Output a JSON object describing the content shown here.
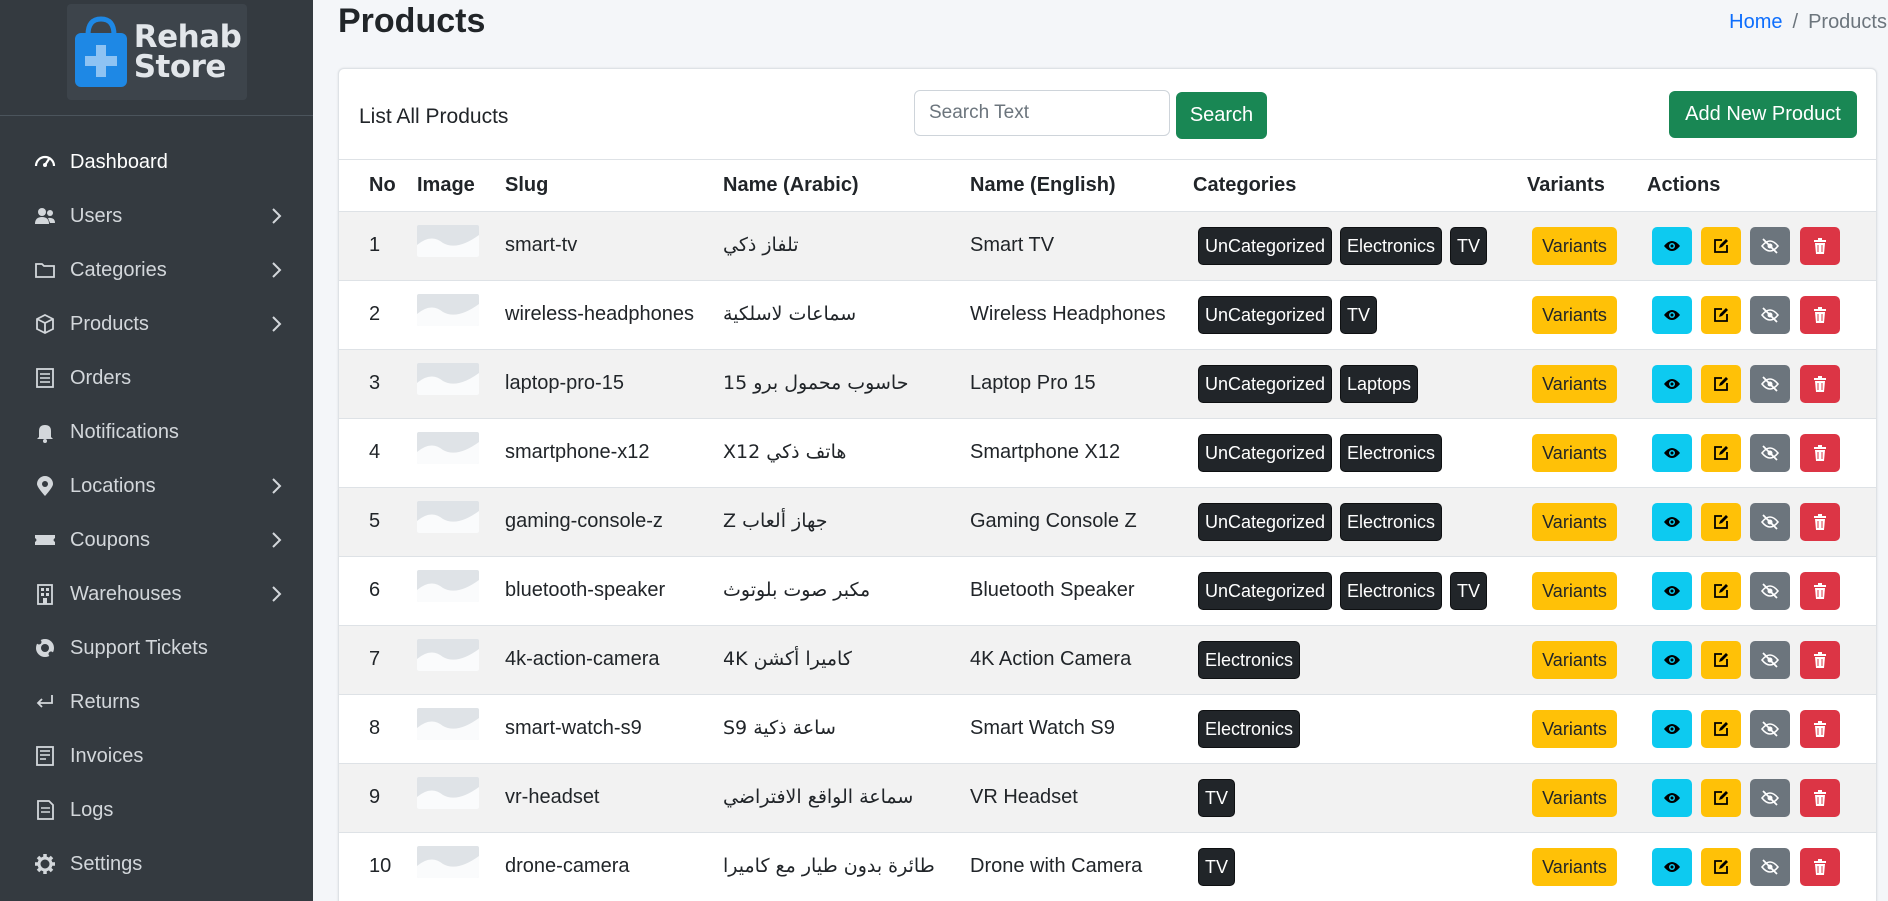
{
  "sidebar": {
    "brand": {
      "line1": "Rehab",
      "line2": "Store",
      "icon": "shopping-bag-plus-icon",
      "accent": "#1e88e5"
    },
    "items": [
      {
        "label": "Dashboard",
        "icon": "gauge-icon",
        "active": true,
        "has_submenu": false
      },
      {
        "label": "Users",
        "icon": "users-icon",
        "active": false,
        "has_submenu": true
      },
      {
        "label": "Categories",
        "icon": "folder-icon",
        "active": false,
        "has_submenu": true
      },
      {
        "label": "Products",
        "icon": "cube-icon",
        "active": false,
        "has_submenu": true
      },
      {
        "label": "Orders",
        "icon": "receipt-icon",
        "active": false,
        "has_submenu": false
      },
      {
        "label": "Notifications",
        "icon": "bell-icon",
        "active": false,
        "has_submenu": false
      },
      {
        "label": "Locations",
        "icon": "map-pin-icon",
        "active": false,
        "has_submenu": true
      },
      {
        "label": "Coupons",
        "icon": "ticket-icon",
        "active": false,
        "has_submenu": true
      },
      {
        "label": "Warehouses",
        "icon": "building-icon",
        "active": false,
        "has_submenu": true
      },
      {
        "label": "Support Tickets",
        "icon": "life-ring-icon",
        "active": false,
        "has_submenu": false
      },
      {
        "label": "Returns",
        "icon": "return-arrow-icon",
        "active": false,
        "has_submenu": false
      },
      {
        "label": "Invoices",
        "icon": "invoice-icon",
        "active": false,
        "has_submenu": false
      },
      {
        "label": "Logs",
        "icon": "log-file-icon",
        "active": false,
        "has_submenu": false
      },
      {
        "label": "Settings",
        "icon": "gear-icon",
        "active": false,
        "has_submenu": false
      }
    ]
  },
  "header": {
    "title": "Products",
    "breadcrumb": {
      "home": "Home",
      "separator": "/",
      "current": "Products"
    }
  },
  "card": {
    "title": "List All Products",
    "search_placeholder": "Search Text",
    "search_button": "Search",
    "add_button": "Add New Product"
  },
  "table": {
    "columns": [
      "No",
      "Image",
      "Slug",
      "Name (Arabic)",
      "Name (English)",
      "Categories",
      "Variants",
      "Actions"
    ],
    "rows": [
      {
        "no": "1",
        "slug": "smart-tv",
        "name_ar": "تلفاز ذكي",
        "name_en": "Smart TV",
        "categories": [
          "UnCategorized",
          "Electronics",
          "TV"
        ],
        "variants": "Variants"
      },
      {
        "no": "2",
        "slug": "wireless-headphones",
        "name_ar": "سماعات لاسلكية",
        "name_en": "Wireless Headphones",
        "categories": [
          "UnCategorized",
          "TV"
        ],
        "variants": "Variants"
      },
      {
        "no": "3",
        "slug": "laptop-pro-15",
        "name_ar": "حاسوب محمول برو 15",
        "name_en": "Laptop Pro 15",
        "categories": [
          "UnCategorized",
          "Laptops"
        ],
        "variants": "Variants"
      },
      {
        "no": "4",
        "slug": "smartphone-x12",
        "name_ar": "هاتف ذكي X12",
        "name_en": "Smartphone X12",
        "categories": [
          "UnCategorized",
          "Electronics"
        ],
        "variants": "Variants"
      },
      {
        "no": "5",
        "slug": "gaming-console-z",
        "name_ar": "جهاز ألعاب Z",
        "name_en": "Gaming Console Z",
        "categories": [
          "UnCategorized",
          "Electronics"
        ],
        "variants": "Variants"
      },
      {
        "no": "6",
        "slug": "bluetooth-speaker",
        "name_ar": "مكبر صوت بلوتوث",
        "name_en": "Bluetooth Speaker",
        "categories": [
          "UnCategorized",
          "Electronics",
          "TV"
        ],
        "variants": "Variants"
      },
      {
        "no": "7",
        "slug": "4k-action-camera",
        "name_ar": "كاميرا أكشن 4K",
        "name_en": "4K Action Camera",
        "categories": [
          "Electronics"
        ],
        "variants": "Variants"
      },
      {
        "no": "8",
        "slug": "smart-watch-s9",
        "name_ar": "ساعة ذكية S9",
        "name_en": "Smart Watch S9",
        "categories": [
          "Electronics"
        ],
        "variants": "Variants"
      },
      {
        "no": "9",
        "slug": "vr-headset",
        "name_ar": "سماعة الواقع الافتراضي",
        "name_en": "VR Headset",
        "categories": [
          "TV"
        ],
        "variants": "Variants"
      },
      {
        "no": "10",
        "slug": "drone-camera",
        "name_ar": "طائرة بدون طيار مع كاميرا",
        "name_en": "Drone with Camera",
        "categories": [
          "TV"
        ],
        "variants": "Variants"
      }
    ],
    "action_icons": [
      "eye-icon",
      "pencil-square-icon",
      "eye-slash-icon",
      "trash-icon"
    ]
  },
  "colors": {
    "sidebar_bg": "#343a40",
    "success": "#198754",
    "warning": "#ffc107",
    "info": "#0dcaf0",
    "secondary": "#6c757d",
    "danger": "#dc3545",
    "badge_dark": "#212529"
  }
}
